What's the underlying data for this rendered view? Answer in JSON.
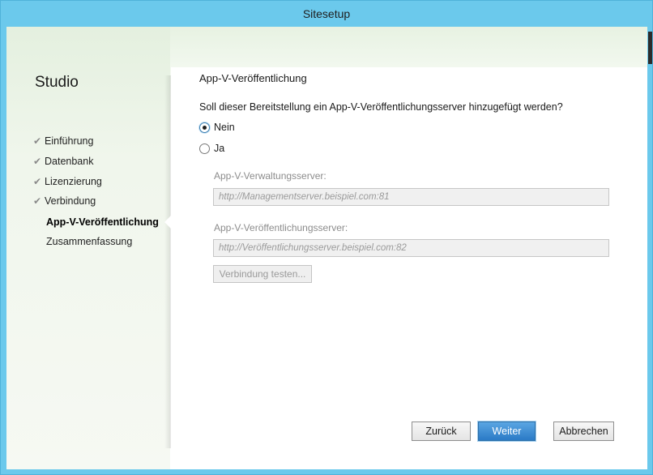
{
  "window": {
    "title": "Sitesetup"
  },
  "sidebar": {
    "title": "Studio",
    "items": [
      {
        "label": "Einführung",
        "state": "done"
      },
      {
        "label": "Datenbank",
        "state": "done"
      },
      {
        "label": "Lizenzierung",
        "state": "done"
      },
      {
        "label": "Verbindung",
        "state": "done"
      },
      {
        "label": "App-V-Veröffentlichung",
        "state": "active"
      },
      {
        "label": "Zusammenfassung",
        "state": "pending"
      }
    ],
    "check_glyph": "✔"
  },
  "main": {
    "title": "App-V-Veröffentlichung",
    "question": "Soll dieser Bereitstellung ein App-V-Veröffentlichungsserver hinzugefügt werden?",
    "options": [
      {
        "label": "Nein",
        "selected": true
      },
      {
        "label": "Ja",
        "selected": false
      }
    ],
    "management_label": "App-V-Verwaltungsserver:",
    "management_placeholder": "http://Managementserver.beispiel.com:81",
    "publishing_label": "App-V-Veröffentlichungsserver:",
    "publishing_placeholder": "http://Veröffentlichungsserver.beispiel.com:82",
    "test_button": "Verbindung testen..."
  },
  "footer": {
    "back": "Zurück",
    "next": "Weiter",
    "cancel": "Abbrechen"
  },
  "colors": {
    "titlebar": "#6bc9ec",
    "primary_button": "#2b7ac6"
  }
}
